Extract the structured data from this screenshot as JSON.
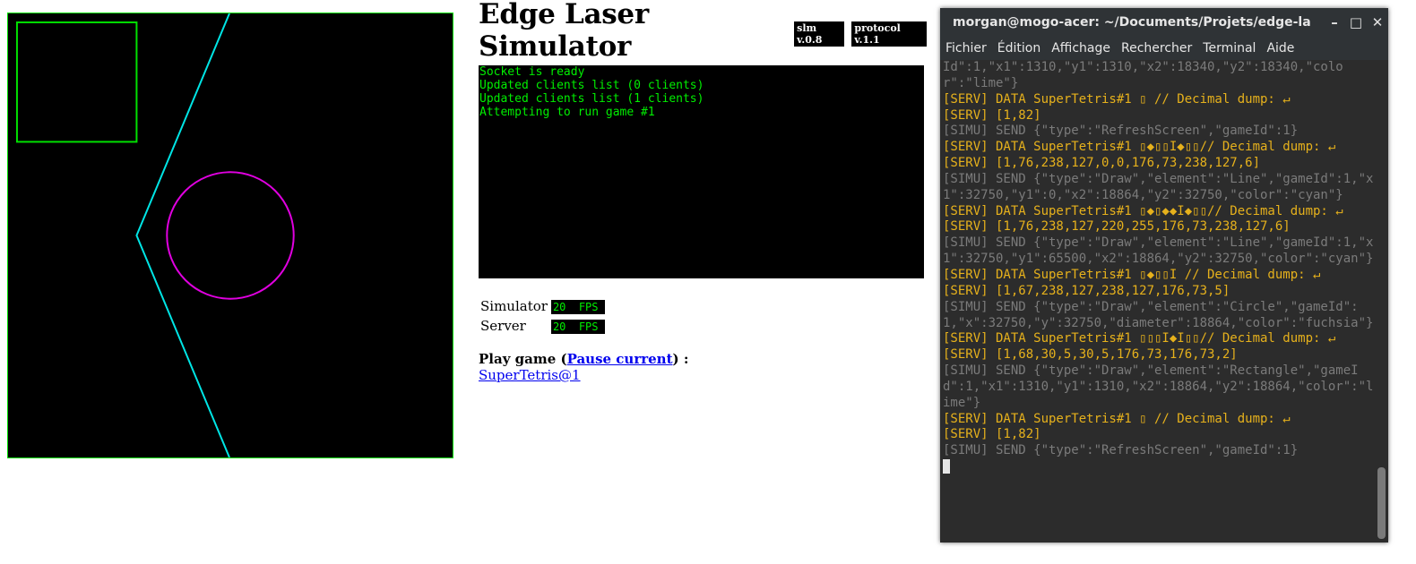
{
  "canvas": {
    "colors": {
      "border": "#00e000",
      "rect": "#00e000",
      "line": "#00e5e5",
      "circle": "#e000e0"
    }
  },
  "simulator": {
    "title": "Edge Laser Simulator",
    "sim_version": "slm v.0.8",
    "protocol_version": "protocol v.1.1",
    "log": [
      "Socket is ready",
      "Updated clients list (0 clients)",
      "Updated clients list (1 clients)",
      "Attempting to run game #1"
    ],
    "fps": [
      {
        "label": "Simulator",
        "value": "20  FPS"
      },
      {
        "label": "Server",
        "value": "20  FPS"
      }
    ],
    "play": {
      "prefix": "Play game (",
      "pause_link": "Pause current",
      "suffix": ") :",
      "game_link": "SuperTetris@1"
    }
  },
  "terminal": {
    "title": "morgan@mogo-acer: ~/Documents/Projets/edge-laser-s…",
    "controls": [
      "–",
      "□",
      "✕"
    ],
    "menu": [
      "Fichier",
      "Édition",
      "Affichage",
      "Rechercher",
      "Terminal",
      "Aide"
    ],
    "lines": [
      {
        "kind": "simu",
        "text": "Id\":1,\"x1\":1310,\"y1\":1310,\"x2\":18340,\"y2\":18340,\"color\":\"lime\"}"
      },
      {
        "kind": "serv",
        "text": "[SERV] DATA SuperTetris#1 ▯ // Decimal dump: ↵"
      },
      {
        "kind": "serv",
        "text": "[SERV] [1,82]"
      },
      {
        "kind": "simu",
        "text": "[SIMU] SEND {\"type\":\"RefreshScreen\",\"gameId\":1}"
      },
      {
        "kind": "serv",
        "text": "[SERV] DATA SuperTetris#1 ▯◆▯▯I◆▯▯// Decimal dump: ↵"
      },
      {
        "kind": "serv",
        "text": "[SERV] [1,76,238,127,0,0,176,73,238,127,6]"
      },
      {
        "kind": "simu",
        "text": "[SIMU] SEND {\"type\":\"Draw\",\"element\":\"Line\",\"gameId\":1,\"x1\":32750,\"y1\":0,\"x2\":18864,\"y2\":32750,\"color\":\"cyan\"}"
      },
      {
        "kind": "serv",
        "text": "[SERV] DATA SuperTetris#1 ▯◆▯◆◆I◆▯▯// Decimal dump: ↵"
      },
      {
        "kind": "serv",
        "text": ""
      },
      {
        "kind": "serv",
        "text": "[SERV] [1,76,238,127,220,255,176,73,238,127,6]"
      },
      {
        "kind": "simu",
        "text": "[SIMU] SEND {\"type\":\"Draw\",\"element\":\"Line\",\"gameId\":1,\"x1\":32750,\"y1\":65500,\"x2\":18864,\"y2\":32750,\"color\":\"cyan\"}"
      },
      {
        "kind": "serv",
        "text": "[SERV] DATA SuperTetris#1 ▯◆▯▯I // Decimal dump: ↵"
      },
      {
        "kind": "serv",
        "text": "[SERV] [1,67,238,127,238,127,176,73,5]"
      },
      {
        "kind": "simu",
        "text": "[SIMU] SEND {\"type\":\"Draw\",\"element\":\"Circle\",\"gameId\":1,\"x\":32750,\"y\":32750,\"diameter\":18864,\"color\":\"fuchsia\"}"
      },
      {
        "kind": "serv",
        "text": "[SERV] DATA SuperTetris#1 ▯▯▯I◆I▯▯// Decimal dump: ↵"
      },
      {
        "kind": "serv",
        "text": "[SERV] [1,68,30,5,30,5,176,73,176,73,2]"
      },
      {
        "kind": "simu",
        "text": "[SIMU] SEND {\"type\":\"Draw\",\"element\":\"Rectangle\",\"gameId\":1,\"x1\":1310,\"y1\":1310,\"x2\":18864,\"y2\":18864,\"color\":\"lime\"}"
      },
      {
        "kind": "serv",
        "text": "[SERV] DATA SuperTetris#1 ▯ // Decimal dump: ↵"
      },
      {
        "kind": "serv",
        "text": "[SERV] [1,82]"
      },
      {
        "kind": "simu",
        "text": "[SIMU] SEND {\"type\":\"RefreshScreen\",\"gameId\":1}"
      }
    ]
  }
}
